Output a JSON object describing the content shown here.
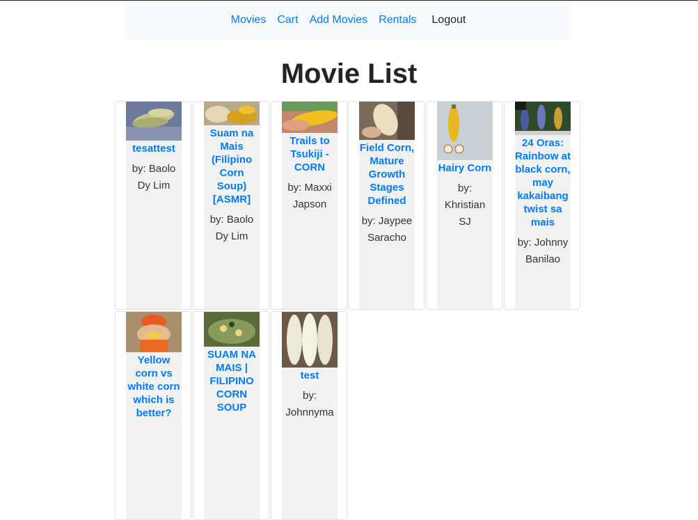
{
  "nav": {
    "movies": "Movies",
    "cart": "Cart",
    "add_movies": "Add Movies",
    "rentals": "Rentals",
    "logout": "Logout"
  },
  "page": {
    "title": "Movie List"
  },
  "movies": [
    {
      "title": "tesattest",
      "author": "by: Baolo Dy Lim"
    },
    {
      "title": "Suam na Mais (Filipino Corn Soup) [ASMR]",
      "author": "by: Baolo Dy Lim"
    },
    {
      "title": "Trails to Tsukiji - CORN",
      "author": "by: Maxxi Japson"
    },
    {
      "title": "Field Corn, Mature Growth Stages Defined",
      "author": "by: Jaypee Saracho"
    },
    {
      "title": "Hairy Corn",
      "author": "by: Khristian SJ"
    },
    {
      "title": "24 Oras: Rainbow at black corn, may kakaibang twist sa mais",
      "author": "by: Johnny Banilao"
    },
    {
      "title": "Yellow corn vs white corn which is better?",
      "author": ""
    },
    {
      "title": "SUAM NA MAIS | FILIPINO CORN SOUP",
      "author": ""
    },
    {
      "title": "test",
      "author": "by: Johnnyma"
    }
  ]
}
